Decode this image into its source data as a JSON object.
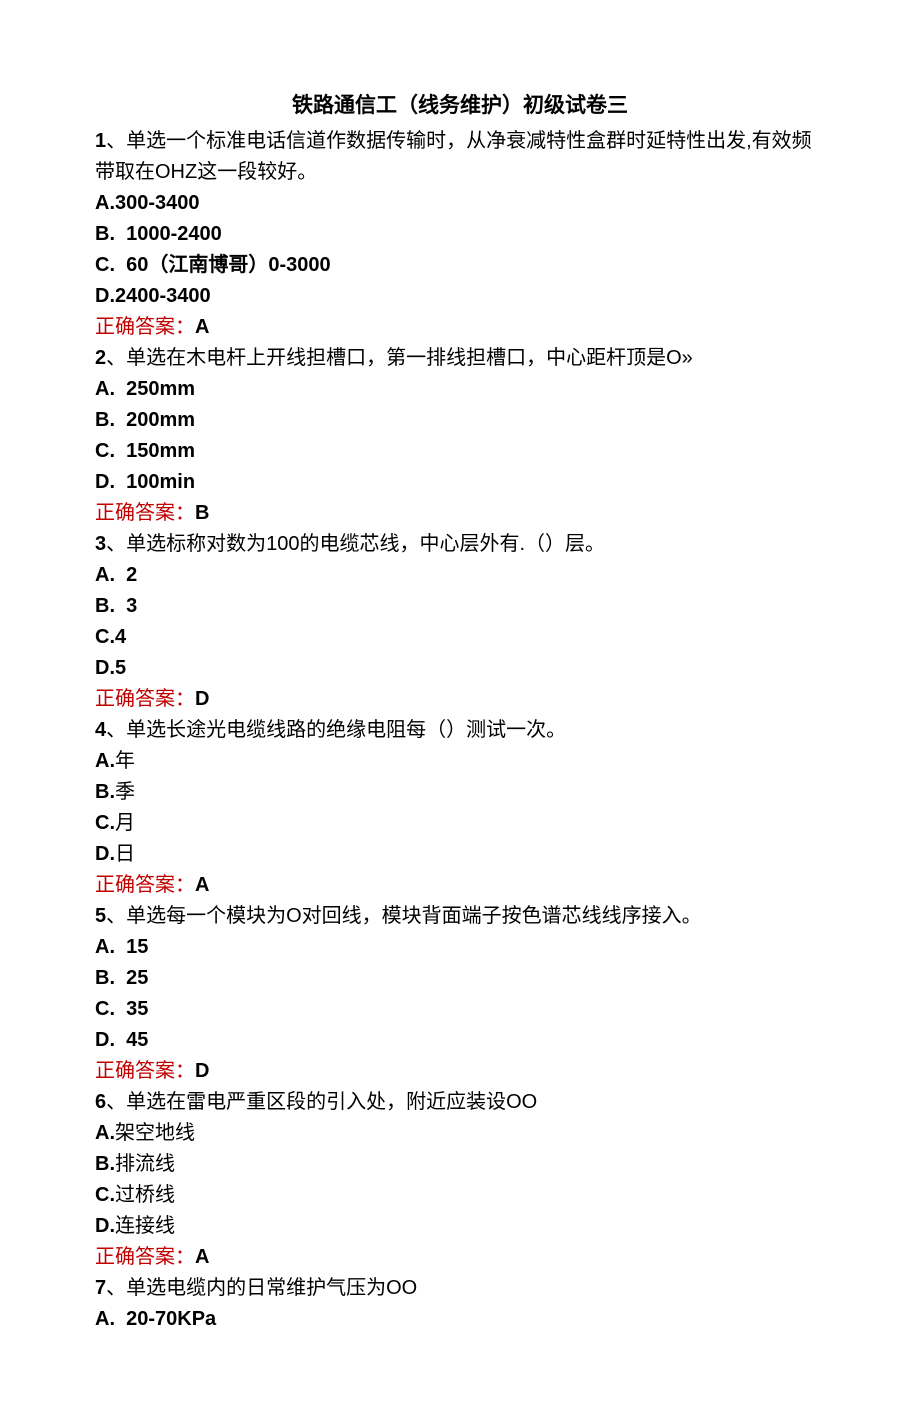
{
  "title": "铁路通信工（线务维护）初级试卷三",
  "questions": [
    {
      "num": "1",
      "type": "单选",
      "text": "一个标准电话信道作数据传输时，从净衰减特性盒群时延特性出发,有效频带取在OHZ这一段较好。",
      "options": [
        {
          "label": "A.",
          "text": "300-3400"
        },
        {
          "label": "B.",
          "text": "1000-2400"
        },
        {
          "label": "C.",
          "text": "60（江南博哥）0-3000"
        },
        {
          "label": "D.",
          "text": "2400-3400"
        }
      ],
      "answer": "A"
    },
    {
      "num": "2",
      "type": "单选",
      "text": "在木电杆上开线担槽口，第一排线担槽口，中心距杆顶是O»",
      "options": [
        {
          "label": "A.",
          "text": "250mm"
        },
        {
          "label": "B.",
          "text": "200mm"
        },
        {
          "label": "C.",
          "text": "150mm"
        },
        {
          "label": "D.",
          "text": "100min"
        }
      ],
      "answer": "B"
    },
    {
      "num": "3",
      "type": "单选",
      "text": "标称对数为100的电缆芯线，中心层外有.（）层。",
      "options": [
        {
          "label": "A.",
          "text": "2"
        },
        {
          "label": "B.",
          "text": "3"
        },
        {
          "label": "C.",
          "text": "4"
        },
        {
          "label": "D.",
          "text": "5"
        }
      ],
      "answer": "D"
    },
    {
      "num": "4",
      "type": "单选",
      "text": "长途光电缆线路的绝缘电阻每（）测试一次。",
      "options": [
        {
          "label": "A.",
          "text": "年"
        },
        {
          "label": "B.",
          "text": "季"
        },
        {
          "label": "C.",
          "text": "月"
        },
        {
          "label": "D.",
          "text": "日"
        }
      ],
      "answer": "A"
    },
    {
      "num": "5",
      "type": "单选",
      "text": "每一个模块为O对回线，模块背面端子按色谱芯线线序接入。",
      "options": [
        {
          "label": "A.",
          "text": "15"
        },
        {
          "label": "B.",
          "text": "25"
        },
        {
          "label": "C.",
          "text": "35"
        },
        {
          "label": "D.",
          "text": "45"
        }
      ],
      "answer": "D"
    },
    {
      "num": "6",
      "type": "单选",
      "text": "在雷电严重区段的引入处，附近应装设OO",
      "options": [
        {
          "label": "A.",
          "text": "架空地线"
        },
        {
          "label": "B.",
          "text": "排流线"
        },
        {
          "label": "C.",
          "text": "过桥线"
        },
        {
          "label": "D.",
          "text": "连接线"
        }
      ],
      "answer": "A"
    },
    {
      "num": "7",
      "type": "单选",
      "text": "电缆内的日常维护气压为OO",
      "options": [
        {
          "label": "A.",
          "text": "20-70KPa"
        }
      ],
      "answer": null
    }
  ],
  "answer_label": "正确答案："
}
